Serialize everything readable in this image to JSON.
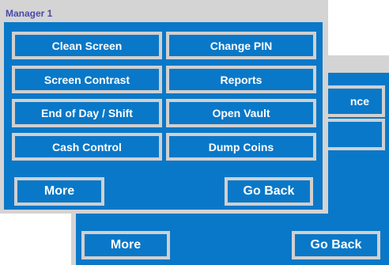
{
  "back_window": {
    "partial_labels": [
      "nce"
    ],
    "buttons": {
      "more": "More",
      "go_back": "Go Back"
    }
  },
  "front_window": {
    "title": "Manager 1",
    "menu": {
      "clean_screen": "Clean Screen",
      "change_pin": "Change PIN",
      "screen_contrast": "Screen Contrast",
      "reports": "Reports",
      "end_of_day": "End of Day / Shift",
      "open_vault": "Open Vault",
      "cash_control": "Cash Control",
      "dump_coins": "Dump Coins"
    },
    "buttons": {
      "more": "More",
      "go_back": "Go Back"
    }
  },
  "colors": {
    "panel_blue": "#0a78c8",
    "panel_gray": "#d4d4d4",
    "title_text": "#4a4aa8",
    "button_border": "#d0d0d0"
  }
}
